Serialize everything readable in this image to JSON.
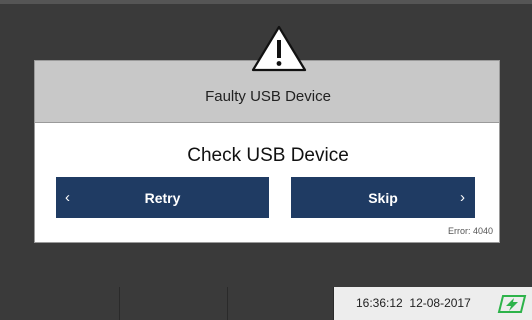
{
  "dialog": {
    "title": "Faulty USB Device",
    "message": "Check USB Device",
    "retry_label": "Retry",
    "skip_label": "Skip",
    "error_code": "Error: 4040",
    "icon": "warning-triangle-icon"
  },
  "status_bar": {
    "time": "16:36:12",
    "date": "12-08-2017",
    "power_icon": "battery-charging-icon"
  },
  "colors": {
    "button_bg": "#1f3b63",
    "header_bg": "#c8c8c8",
    "screen_bg": "#3a3a3a",
    "power_icon_green": "#2db34a"
  }
}
